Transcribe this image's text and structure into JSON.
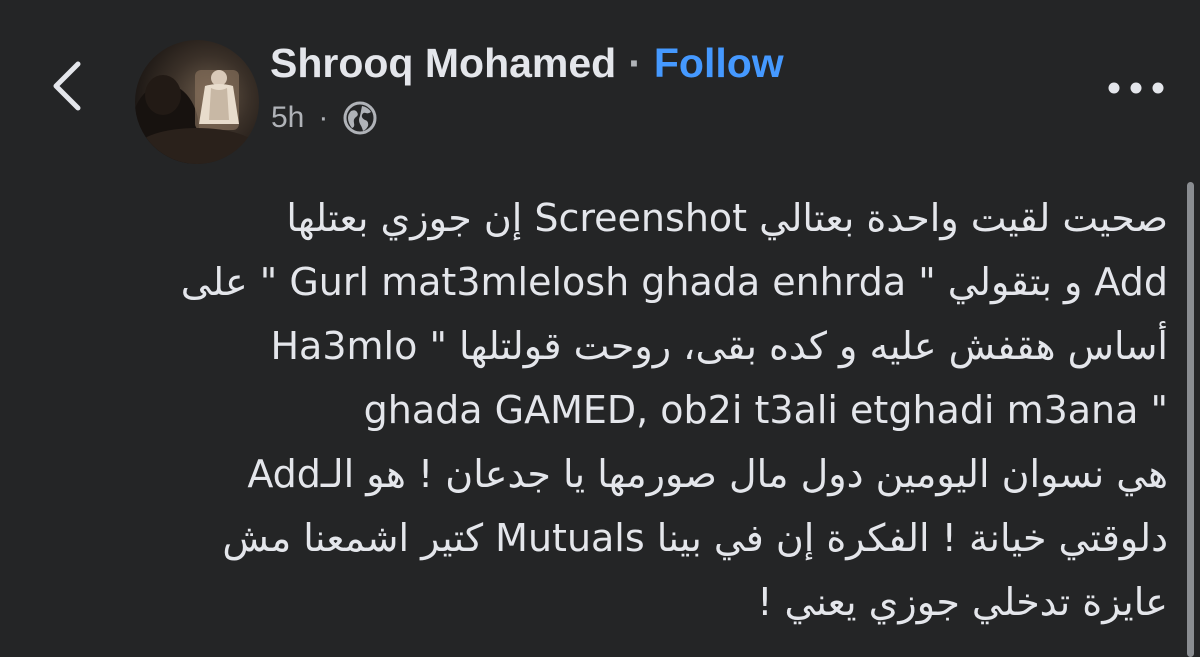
{
  "nav": {
    "back_icon": "chevron-left-icon"
  },
  "post": {
    "author": {
      "name": "Shrooq Mohamed",
      "separator": "·",
      "follow_label": "Follow",
      "avatar_icon": "profile-photo"
    },
    "meta": {
      "time": "5h",
      "separator": "·",
      "audience_icon": "globe-icon"
    },
    "more_icon": "ellipsis-icon",
    "body_lines": [
      "صحيت لقيت واحدة بعتالي Screenshot  إن جوزي بعتلها",
      "Add و بتقولي \" Gurl mat3mlelosh ghada enhrda \" على",
      "أساس هقفش عليه و كده بقى، روحت قولتلها \" Ha3mlo",
      "\" ghada GAMED, ob2i t3ali etghadi m3ana",
      "هي نسوان اليومين دول مال صورمها يا جدعان ! هو الـAdd",
      "دلوقتي خيانة ! الفكرة إن في بينا Mutuals كتير اشمعنا مش",
      "عايزة تدخلي جوزي يعني !"
    ]
  },
  "colors": {
    "background": "#242526",
    "text": "#e4e6eb",
    "secondary_text": "#b0b3b8",
    "link_blue": "#4599ff"
  }
}
